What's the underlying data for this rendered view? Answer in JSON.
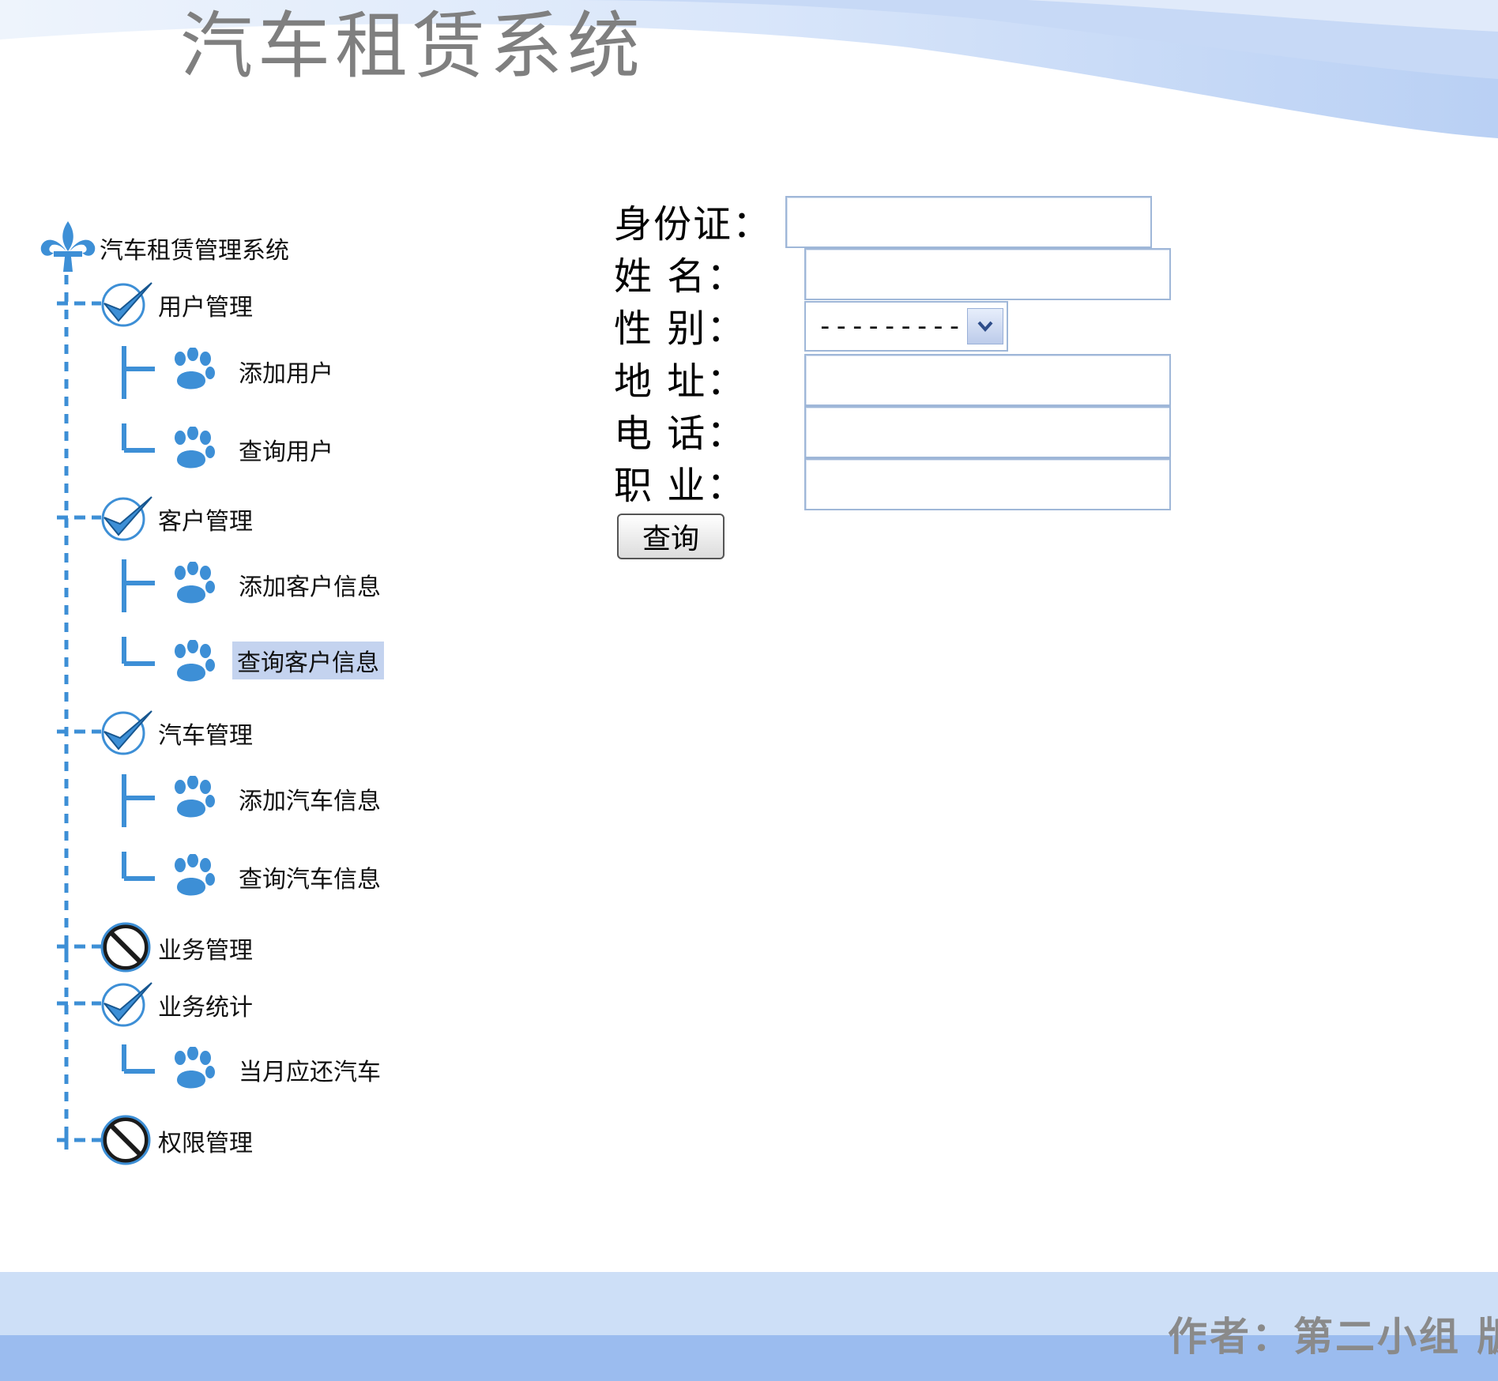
{
  "app": {
    "title": "汽车租赁系统"
  },
  "tree": {
    "root": {
      "label": "汽车租赁管理系统",
      "icon": "fleur-de-lis-icon"
    },
    "groups": [
      {
        "label": "用户管理",
        "status": "expanded",
        "icon": "checkmark-icon",
        "items": [
          {
            "label": "添加用户",
            "icon": "paw-icon"
          },
          {
            "label": "查询用户",
            "icon": "paw-icon"
          }
        ]
      },
      {
        "label": "客户管理",
        "status": "expanded",
        "icon": "checkmark-icon",
        "items": [
          {
            "label": "添加客户信息",
            "icon": "paw-icon"
          },
          {
            "label": "查询客户信息",
            "icon": "paw-icon",
            "selected": true
          }
        ]
      },
      {
        "label": "汽车管理",
        "status": "expanded",
        "icon": "checkmark-icon",
        "items": [
          {
            "label": "添加汽车信息",
            "icon": "paw-icon"
          },
          {
            "label": "查询汽车信息",
            "icon": "paw-icon"
          }
        ]
      },
      {
        "label": "业务管理",
        "status": "collapsed",
        "icon": "no-entry-icon",
        "items": []
      },
      {
        "label": "业务统计",
        "status": "expanded",
        "icon": "checkmark-icon",
        "items": [
          {
            "label": "当月应还汽车",
            "icon": "paw-icon"
          }
        ]
      },
      {
        "label": "权限管理",
        "status": "collapsed",
        "icon": "no-entry-icon",
        "items": []
      }
    ]
  },
  "form": {
    "id_label": "身份证：",
    "name_label": "姓 名：",
    "gender_label": "性 别：",
    "gender_value": "---------",
    "address_label": "地 址：",
    "phone_label": "电 话：",
    "job_label": "职 业：",
    "query_button": "查询"
  },
  "footer": {
    "text": "作者：第二小组 版"
  },
  "colors": {
    "tree_blue": "#3d8fd6",
    "selection": "#c4d3ef",
    "footer_light": "#cddff7",
    "footer_dark": "#9bbcef"
  }
}
